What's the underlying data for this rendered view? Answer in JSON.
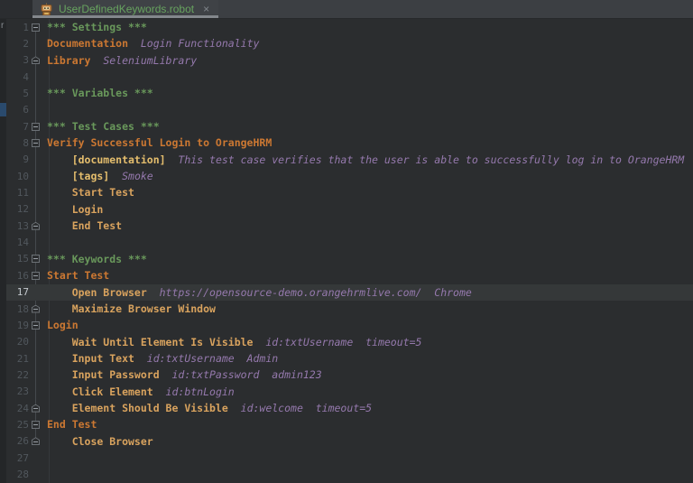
{
  "colors": {
    "bg_editor": "#2B2D2F",
    "bg_tabbar": "#3C3F43",
    "bg_tab_active": "#3F4246",
    "bg_strip": "#242628",
    "bg_strip_top": "#2B2D30",
    "strip_selection": "#2A4A6D",
    "bg_line_highlight": "#353839",
    "tab_title": "#67A35F",
    "tab_underline": "#83878C",
    "gutter_number": "#51575D",
    "gutter_number_active": "#C4C9CE",
    "c_section": "#69985B",
    "c_keyword": "#CC7832",
    "c_call": "#D9A35E",
    "c_meta": "#E5BE6D",
    "c_arg": "#9579AD"
  },
  "tab": {
    "title": "UserDefinedKeywords.robot",
    "close_label": "×",
    "icon": "robot-file-icon"
  },
  "project_strip": {
    "text_fragment": "r"
  },
  "editor": {
    "lines": [
      {
        "n": "1",
        "fold": "start",
        "seg": [
          [
            "sec",
            "*** Settings ***"
          ]
        ]
      },
      {
        "n": "2",
        "fold": "",
        "seg": [
          [
            "kw",
            "Documentation"
          ],
          [
            "arg",
            "  Login Functionality"
          ]
        ]
      },
      {
        "n": "3",
        "fold": "end",
        "seg": [
          [
            "kw",
            "Library"
          ],
          [
            "arg",
            "  SeleniumLibrary"
          ]
        ]
      },
      {
        "n": "4",
        "fold": "",
        "seg": []
      },
      {
        "n": "5",
        "fold": "",
        "seg": [
          [
            "sec",
            "*** Variables ***"
          ]
        ]
      },
      {
        "n": "6",
        "fold": "",
        "seg": []
      },
      {
        "n": "7",
        "fold": "start",
        "seg": [
          [
            "sec",
            "*** Test Cases ***"
          ]
        ]
      },
      {
        "n": "8",
        "fold": "start",
        "seg": [
          [
            "kw",
            "Verify Successful Login to OrangeHRM"
          ]
        ]
      },
      {
        "n": "9",
        "fold": "",
        "seg": [
          [
            "meta",
            "    [documentation]"
          ],
          [
            "arg",
            "  This test case verifies that the user is able to successfully log in to OrangeHRM"
          ]
        ]
      },
      {
        "n": "10",
        "fold": "",
        "seg": [
          [
            "meta",
            "    [tags]"
          ],
          [
            "arg",
            "  Smoke"
          ]
        ]
      },
      {
        "n": "11",
        "fold": "",
        "seg": [
          [
            "call",
            "    Start Test"
          ]
        ]
      },
      {
        "n": "12",
        "fold": "",
        "seg": [
          [
            "call",
            "    Login"
          ]
        ]
      },
      {
        "n": "13",
        "fold": "end",
        "seg": [
          [
            "call",
            "    End Test"
          ]
        ]
      },
      {
        "n": "14",
        "fold": "",
        "seg": []
      },
      {
        "n": "15",
        "fold": "start",
        "seg": [
          [
            "sec",
            "*** Keywords ***"
          ]
        ]
      },
      {
        "n": "16",
        "fold": "start",
        "seg": [
          [
            "kw",
            "Start Test"
          ]
        ]
      },
      {
        "n": "17",
        "fold": "",
        "hl": true,
        "seg": [
          [
            "call",
            "    Open Browser"
          ],
          [
            "arg",
            "  https://opensource-demo.orangehrmlive.com/  Chrome"
          ]
        ]
      },
      {
        "n": "18",
        "fold": "end",
        "seg": [
          [
            "call",
            "    Maximize Browser Window"
          ]
        ]
      },
      {
        "n": "19",
        "fold": "start",
        "seg": [
          [
            "kw",
            "Login"
          ]
        ]
      },
      {
        "n": "20",
        "fold": "",
        "seg": [
          [
            "call",
            "    Wait Until Element Is Visible"
          ],
          [
            "arg",
            "  id:txtUsername  timeout=5"
          ]
        ]
      },
      {
        "n": "21",
        "fold": "",
        "seg": [
          [
            "call",
            "    Input Text"
          ],
          [
            "arg",
            "  id:txtUsername  Admin"
          ]
        ]
      },
      {
        "n": "22",
        "fold": "",
        "seg": [
          [
            "call",
            "    Input Password"
          ],
          [
            "arg",
            "  id:txtPassword  admin123"
          ]
        ]
      },
      {
        "n": "23",
        "fold": "",
        "seg": [
          [
            "call",
            "    Click Element"
          ],
          [
            "arg",
            "  id:btnLogin"
          ]
        ]
      },
      {
        "n": "24",
        "fold": "end",
        "seg": [
          [
            "call",
            "    Element Should Be Visible"
          ],
          [
            "arg",
            "  id:welcome  timeout=5"
          ]
        ]
      },
      {
        "n": "25",
        "fold": "start",
        "seg": [
          [
            "kw",
            "End Test"
          ]
        ]
      },
      {
        "n": "26",
        "fold": "end",
        "seg": [
          [
            "call",
            "    Close Browser"
          ]
        ]
      },
      {
        "n": "27",
        "fold": "",
        "seg": []
      },
      {
        "n": "28",
        "fold": "",
        "seg": []
      }
    ]
  }
}
